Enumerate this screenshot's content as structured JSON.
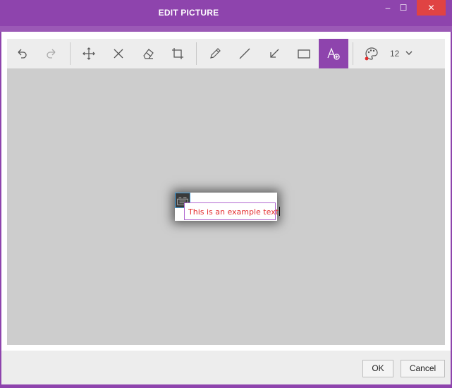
{
  "window": {
    "title": "EDIT PICTURE",
    "minimize_glyph": "–",
    "maximize_glyph": "☐",
    "close_glyph": "✕"
  },
  "toolbar": {
    "tools": [
      {
        "name": "undo",
        "icon": "undo-icon"
      },
      {
        "name": "redo",
        "icon": "redo-icon"
      },
      {
        "name": "move",
        "icon": "move-icon"
      },
      {
        "name": "delete",
        "icon": "close-icon"
      },
      {
        "name": "eraser",
        "icon": "eraser-icon"
      },
      {
        "name": "crop",
        "icon": "crop-icon"
      },
      {
        "name": "pencil",
        "icon": "pencil-icon"
      },
      {
        "name": "line",
        "icon": "line-icon"
      },
      {
        "name": "arrow",
        "icon": "arrow-icon"
      },
      {
        "name": "rectangle",
        "icon": "rectangle-icon"
      },
      {
        "name": "add-text",
        "icon": "add-text-icon",
        "active": true
      },
      {
        "name": "color",
        "icon": "palette-icon"
      }
    ],
    "font_size": "12",
    "active_color": "#e32b2b"
  },
  "canvas": {
    "text": "This is an example text"
  },
  "footer": {
    "ok_label": "OK",
    "cancel_label": "Cancel"
  },
  "colors": {
    "accent": "#8e44ad",
    "close": "#e04343",
    "canvas_bg": "#cdcdcd"
  }
}
